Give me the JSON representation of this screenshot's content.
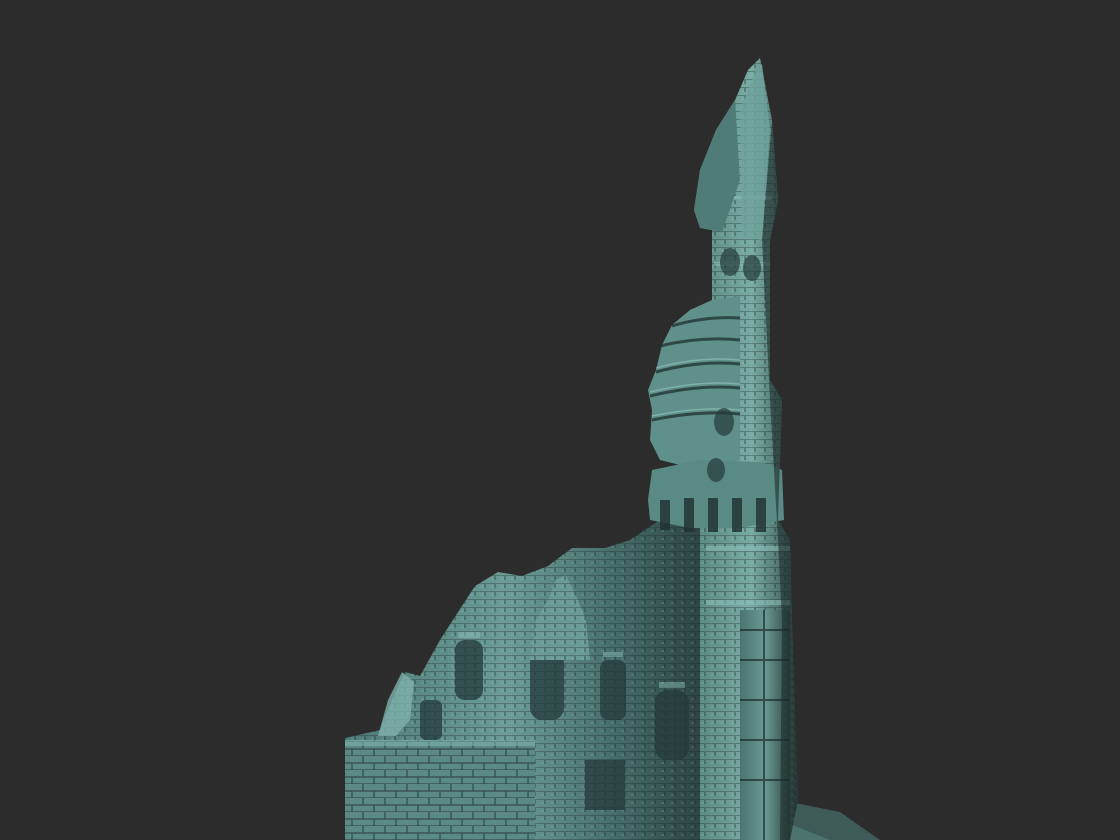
{
  "viewport": {
    "background_color": "#2c2c2c"
  },
  "model": {
    "subject": "sculpted-temple-ruin",
    "material_base_color": "#5c8a86",
    "material_highlight_color": "#8fc4bd",
    "material_shadow_color": "#1d2a29"
  }
}
